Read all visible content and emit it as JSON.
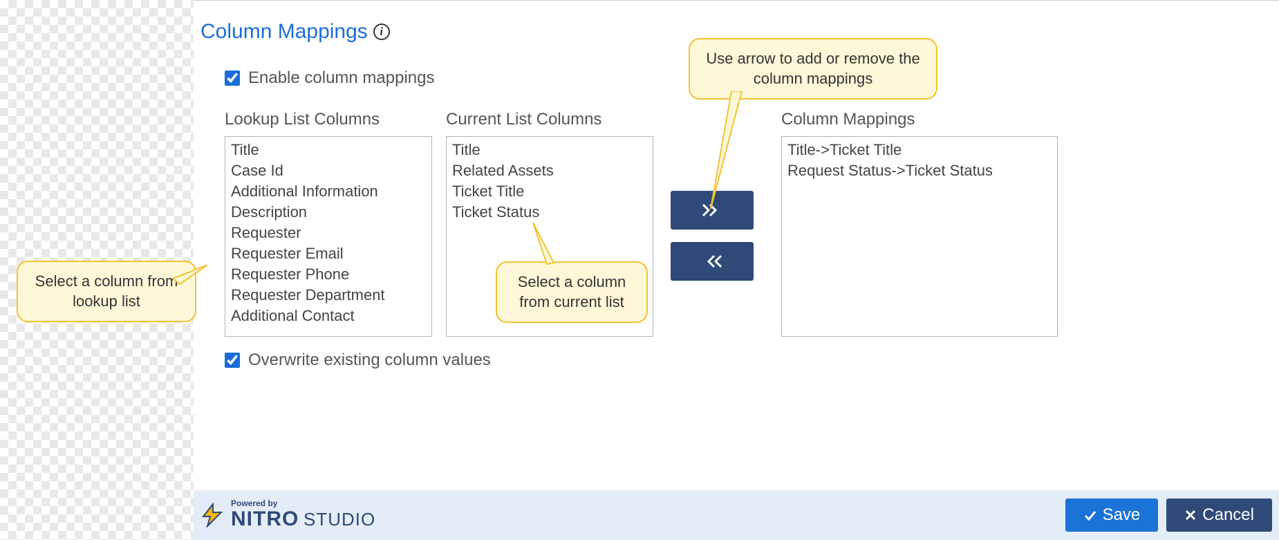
{
  "section": {
    "title": "Column Mappings"
  },
  "controls": {
    "enable_label": "Enable column mappings",
    "overwrite_label": "Overwrite existing column values"
  },
  "headers": {
    "lookup": "Lookup List Columns",
    "current": "Current List Columns",
    "mapping": "Column Mappings"
  },
  "lists": {
    "lookup": [
      "Title",
      "Case Id",
      "Additional Information",
      "Description",
      "Requester",
      "Requester Email",
      "Requester Phone",
      "Requester Department",
      "Additional Contact"
    ],
    "current": [
      "Title",
      "Related Assets",
      "Ticket Title",
      "Ticket Status"
    ],
    "mapping": [
      "Title->Ticket Title",
      "Request Status->Ticket Status"
    ]
  },
  "callouts": {
    "lookup": "Select a column from lookup list",
    "current": "Select a column from current list",
    "arrows": "Use arrow to add or remove the column mappings"
  },
  "footer": {
    "powered": "Powered by",
    "brand1": "NITRO",
    "brand2": "STUDIO",
    "save": "Save",
    "cancel": "Cancel"
  }
}
